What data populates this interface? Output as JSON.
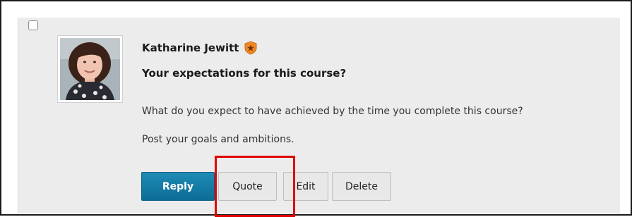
{
  "post": {
    "author": "Katharine Jewitt",
    "role_badge_icon": "star-shield-icon",
    "title": "Your expectations for this course?",
    "body": [
      "What do you expect to have achieved by the time you complete this course?",
      "Post your goals and ambitions."
    ]
  },
  "actions": {
    "reply_label": "Reply",
    "quote_label": "Quote",
    "edit_label": "Edit",
    "delete_label": "Delete"
  },
  "colors": {
    "primary_button": "#0c6d96",
    "highlight": "#e00000",
    "badge": "#f08a24"
  }
}
